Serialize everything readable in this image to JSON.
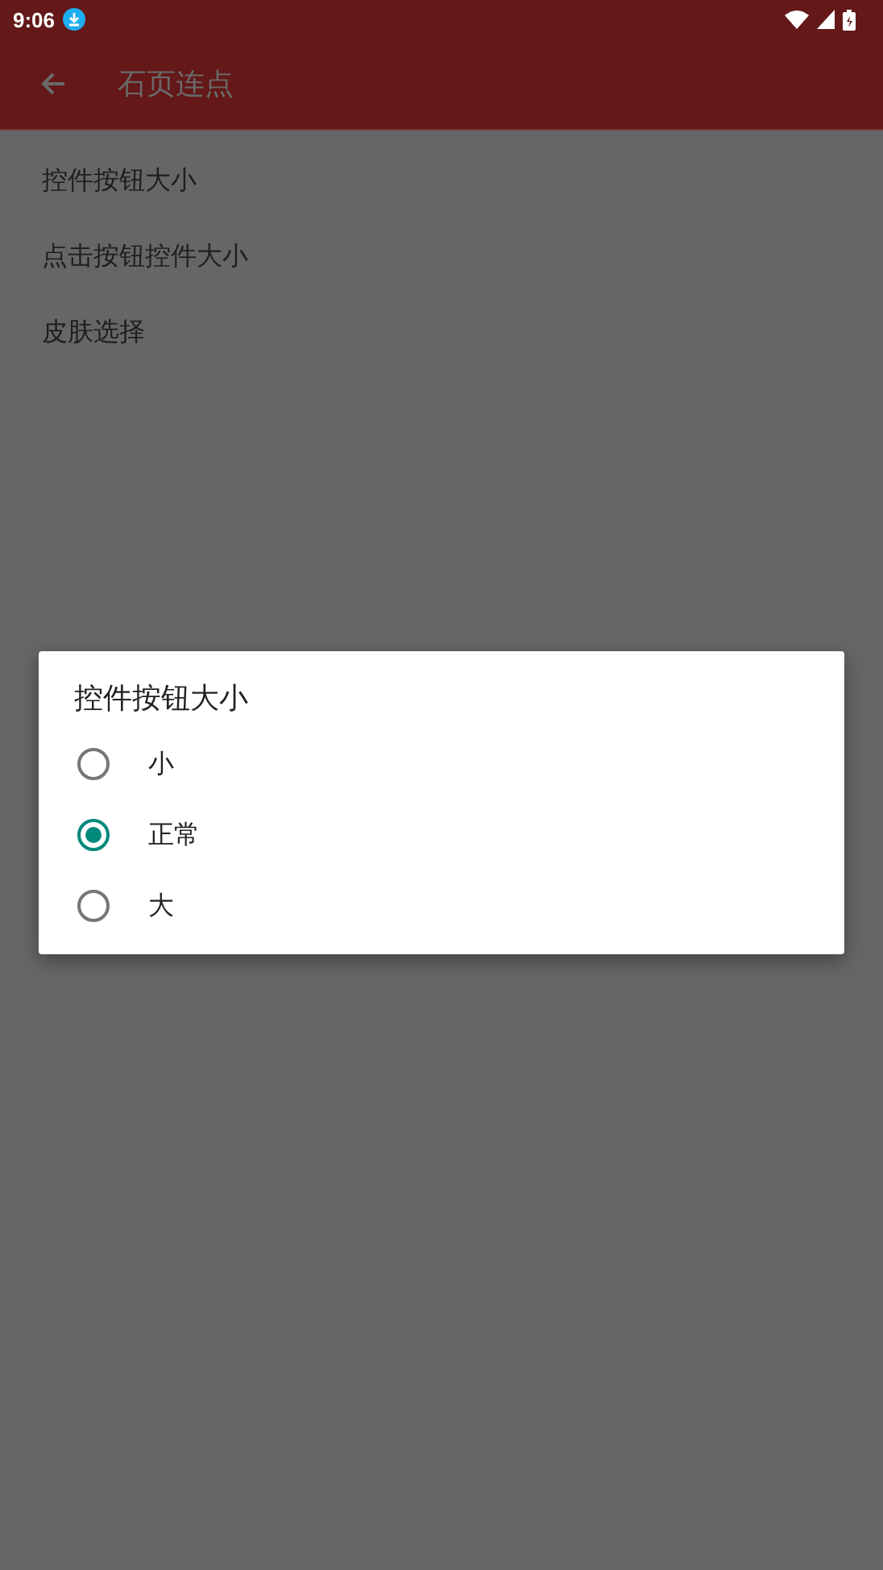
{
  "status_bar": {
    "time": "9:06"
  },
  "toolbar": {
    "title": "石页连点"
  },
  "settings": [
    {
      "label": "控件按钮大小"
    },
    {
      "label": "点击按钮控件大小"
    },
    {
      "label": "皮肤选择"
    }
  ],
  "dialog": {
    "title": "控件按钮大小",
    "options": [
      {
        "label": "小",
        "selected": false
      },
      {
        "label": "正常",
        "selected": true
      },
      {
        "label": "大",
        "selected": false
      }
    ]
  }
}
